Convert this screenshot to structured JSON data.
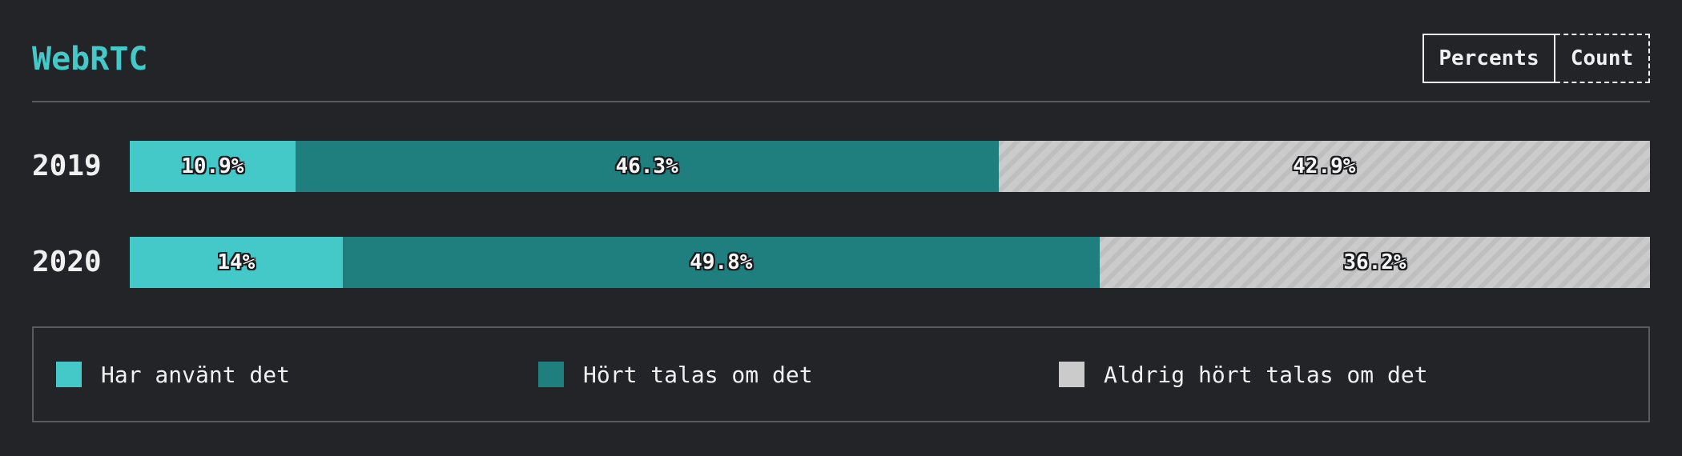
{
  "title": "WebRTC",
  "toggle": {
    "percents_label": "Percents",
    "count_label": "Count",
    "active": "Percents"
  },
  "colors": {
    "used": "#44c8c8",
    "heard": "#1f7f7f",
    "never": "#cbcbcb",
    "title": "#44c8c8",
    "background": "#232428"
  },
  "chart_data": {
    "type": "bar",
    "orientation": "horizontal",
    "stacked": true,
    "title": "WebRTC",
    "categories": [
      "2019",
      "2020"
    ],
    "series": [
      {
        "name": "Har använt det",
        "values": [
          10.9,
          14.0
        ],
        "labels": [
          "10.9%",
          "14%"
        ],
        "color": "#44c8c8"
      },
      {
        "name": "Hört talas om det",
        "values": [
          46.3,
          49.8
        ],
        "labels": [
          "46.3%",
          "49.8%"
        ],
        "color": "#1f7f7f"
      },
      {
        "name": "Aldrig hört talas om det",
        "values": [
          42.9,
          36.2
        ],
        "labels": [
          "42.9%",
          "36.2%"
        ],
        "color": "#cbcbcb"
      }
    ],
    "xlim": [
      0,
      100
    ],
    "legend_position": "bottom"
  }
}
